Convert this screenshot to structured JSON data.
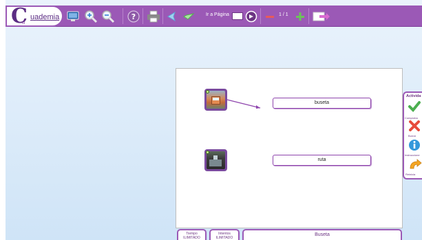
{
  "brand": {
    "initial": "C",
    "sub": "u",
    "name": "uademia"
  },
  "toolbar": {
    "go_to_page_label": "Ir a Página",
    "page_input_value": "",
    "page_counter": "1 / 1"
  },
  "activity": {
    "items": [
      {
        "word": "buseta"
      },
      {
        "word": "ruta"
      }
    ]
  },
  "side_panel": {
    "title": "Activida",
    "check_label": "Comproba",
    "erase_label": "Borrar",
    "instructions_label": "Instruccione",
    "restart_label": "Reinicia"
  },
  "bottom": {
    "time_label": "Tiempo",
    "time_value": "ILIMITADO",
    "attempts_label": "Intentos",
    "attempts_value": "ILIMITADO",
    "title": "Buseta"
  },
  "colors": {
    "brand_purple": "#9b59b6",
    "check_green": "#4caf50",
    "erase_red": "#e74c3c",
    "info_blue": "#3498db",
    "restart_orange": "#f5a623"
  }
}
